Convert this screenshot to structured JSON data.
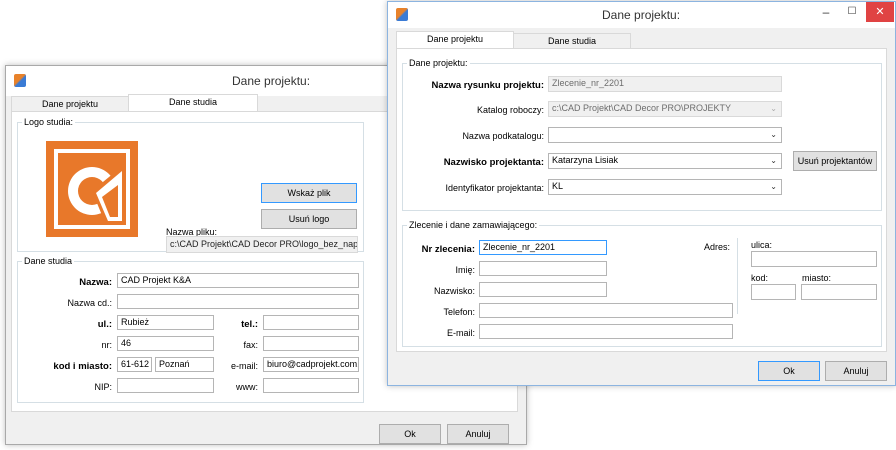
{
  "back": {
    "title": "Dane projektu:",
    "tabs": [
      "Dane projektu",
      "Dane studia"
    ],
    "logo_group": "Logo studia:",
    "choose_file_btn": "Wskaż plik",
    "remove_logo_btn": "Usuń logo",
    "file_name_label": "Nazwa pliku:",
    "file_name_value": "c:\\CAD Projekt\\CAD Decor PRO\\logo_bez_napisu",
    "studio_group": "Dane studia",
    "name_label": "Nazwa:",
    "name_value": "CAD Projekt K&A",
    "name2_label": "Nazwa cd.:",
    "name2_value": "",
    "street_label": "ul.:",
    "street_value": "Rubież",
    "nr_label": "nr:",
    "nr_value": "46",
    "city_label": "kod i miasto:",
    "postal_value": "61-612",
    "city_value": "Poznań",
    "nip_label": "NIP:",
    "nip_value": "",
    "tel_label": "tel.:",
    "tel_value": "",
    "fax_label": "fax:",
    "fax_value": "",
    "email_label": "e-mail:",
    "email_value": "biuro@cadprojekt.com.pl",
    "www_label": "www:",
    "www_value": "",
    "ok": "Ok",
    "cancel": "Anuluj"
  },
  "front": {
    "title": "Dane projektu:",
    "tabs": [
      "Dane projektu",
      "Dane studia"
    ],
    "project_group": "Dane projektu:",
    "drawing_name_label": "Nazwa rysunku projektu:",
    "drawing_name_value": "Zlecenie_nr_2201",
    "work_dir_label": "Katalog roboczy:",
    "work_dir_value": "c:\\CAD Projekt\\CAD Decor PRO\\PROJEKTY",
    "subdir_label": "Nazwa podkatalogu:",
    "subdir_value": "",
    "designer_label": "Nazwisko projektanta:",
    "designer_value": "Katarzyna Lisiak",
    "remove_designers_btn": "Usuń projektantów",
    "designer_id_label": "Identyfikator projektanta:",
    "designer_id_value": "KL",
    "order_group": "Zlecenie i dane zamawiającego:",
    "order_nr_label": "Nr zlecenia:",
    "order_nr_value": "Zlecenie_nr_2201",
    "firstname_label": "Imię:",
    "lastname_label": "Nazwisko:",
    "phone_label": "Telefon:",
    "email_label": "E-mail:",
    "address_label": "Adres:",
    "street_label": "ulica:",
    "postal_label": "kod:",
    "city_label": "miasto:",
    "ok": "Ok",
    "cancel": "Anuluj",
    "minimize": "–",
    "maximize": "☐",
    "close": "✕"
  }
}
